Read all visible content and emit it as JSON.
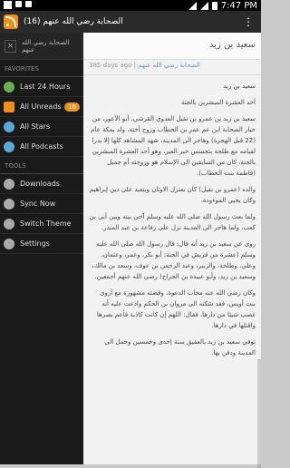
{
  "status_bar": {
    "time": "7:47 PM",
    "battery": "98%"
  },
  "action_bar": {
    "title": "الصحابة رضي الله عنهم (16)"
  },
  "sidebar": {
    "top": {
      "label": "الصحابة رضي الله عنهم"
    },
    "favorites_head": "FAVORITES",
    "items": [
      {
        "label": "Last 24 Hours",
        "icon": "clock-icon"
      },
      {
        "label": "All Unreads",
        "icon": "rss-icon",
        "badge": "16"
      },
      {
        "label": "All Stars",
        "icon": "star-icon"
      },
      {
        "label": "All Podcasts",
        "icon": "podcast-icon"
      }
    ],
    "tools_head": "TOOLS",
    "tools": [
      {
        "label": "Downloads",
        "icon": "download-icon"
      },
      {
        "label": "Sync Now",
        "icon": "sync-icon"
      },
      {
        "label": "Switch Theme",
        "icon": "theme-icon"
      },
      {
        "label": "Settings",
        "icon": "settings-icon"
      }
    ]
  },
  "content": {
    "title": "سعيد بن زيد",
    "meta_source": "الصحابة رضي الله عنهم",
    "meta_time": "385 days ago",
    "body": [
      "سعيد بن زيد",
      "أحد العشرة المبشرين بالجنة",
      "سعيد بن زيد بن عمرو بن نفيل العدوي القرشي، أبو الأعور، من خيار الصحابة ابن عم عمر بن الخطاب وزوج أخته، ولد بمكة عام (22 قبل الهجرة) وهاجر الى المدينة، شهد المشاهد كلها إلا بدرا لقيامه مع طلحة بتجسس خبر العير، وهو أحد العشرة المبشرين بالجنة، كان من السابقين الى الإسلام هو وزوجته أم جميل (فاطمة بنت الخطاب).",
      "والده (عمرو بن نفيل) كان يعتزل الاوثان ويتعبد على دين إبراهيم وكان يحيي الموءودة.",
      "ولما بعث رسول الله صلى الله عليه وسلم آخى بينه وبين أبي بن كعب، ولما هاجر الى المدينة نزل على رفاعة بن عبد المنذر.",
      "روى عن سعيد بن زيد أنه قال: قال رسول الله صلى الله عليه وسلم (عشرة من قريش في الجنة: أبو بكر، وعمر، وعثمان، وعلي، وطلحة، والزبير، وعبد الرحمن بن عوف، وسعد بن مالك، وسعيد بن زيد، وأبو عبيدة بن الجراح) رضي الله عنهم أجمعين.",
      "وكان رضي الله عنه مجاب الدعوة، وقصته مشهورة مع أروى بنت أويس، فقد شكته الى مروان بن الحكم وادعت عليه أنه غصب شيئا من دارها، فقال: اللهم إن كانت كاذبة فأعم بصرها واقتلها في دارها.",
      "توفي سعيد بن زيد بالعقيق سنة إحدى وخمسين وحمل الى المدينة ودفن بها."
    ]
  }
}
